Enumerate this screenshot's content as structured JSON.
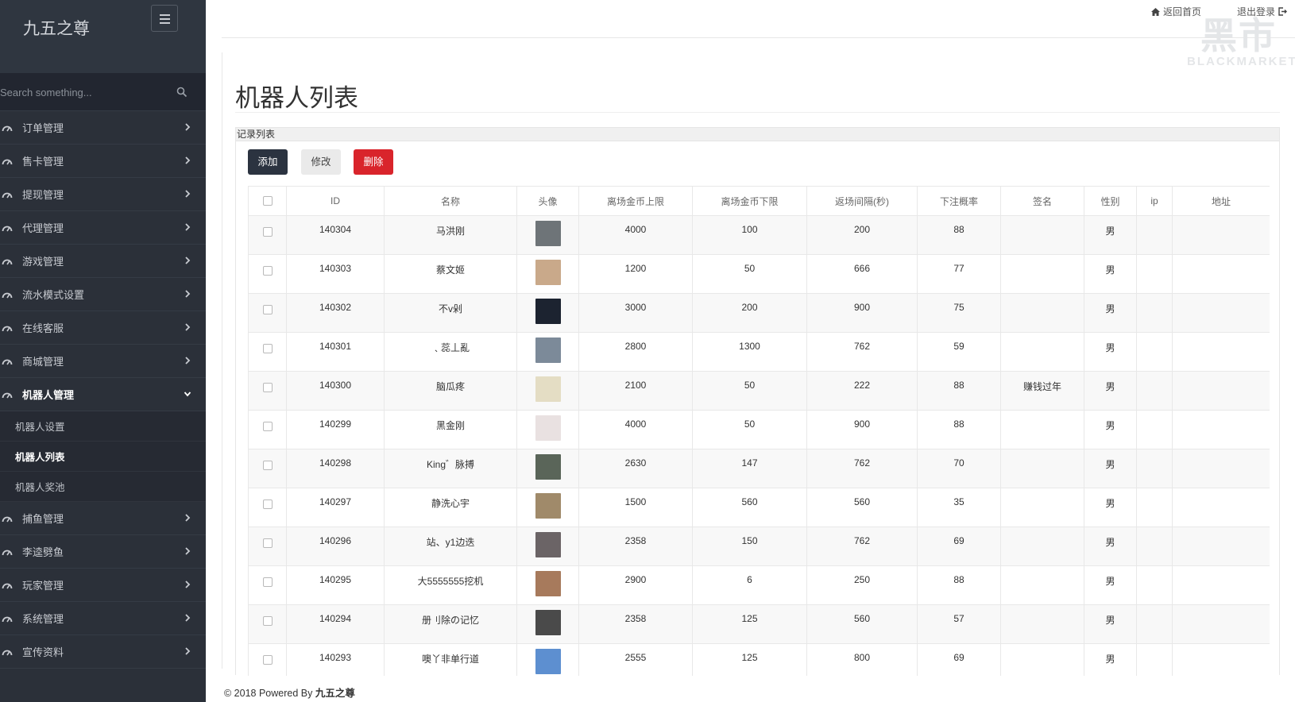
{
  "brand": {
    "title": "九五之尊"
  },
  "search": {
    "placeholder": "Search something..."
  },
  "menu": [
    {
      "label": "订单管理"
    },
    {
      "label": "售卡管理"
    },
    {
      "label": "提现管理"
    },
    {
      "label": "代理管理"
    },
    {
      "label": "游戏管理"
    },
    {
      "label": "流水模式设置"
    },
    {
      "label": "在线客服"
    },
    {
      "label": "商城管理"
    },
    {
      "label": "机器人管理"
    },
    {
      "label": "捕鱼管理"
    },
    {
      "label": "李逵劈鱼"
    },
    {
      "label": "玩家管理"
    },
    {
      "label": "系统管理"
    },
    {
      "label": "宣传资料"
    }
  ],
  "submenu": [
    {
      "label": "机器人设置"
    },
    {
      "label": "机器人列表"
    },
    {
      "label": "机器人奖池"
    }
  ],
  "topbar": {
    "home": "返回首页",
    "logout": "退出登录"
  },
  "watermark": {
    "big": "黑市",
    "small": "BLACKMARKET"
  },
  "page": {
    "title": "机器人列表",
    "panel_title": "记录列表"
  },
  "actions": {
    "add": "添加",
    "edit": "修改",
    "delete": "删除"
  },
  "table": {
    "headers": [
      "ID",
      "名称",
      "头像",
      "离场金币上限",
      "离场金币下限",
      "返场间隔(秒)",
      "下注概率",
      "签名",
      "性别",
      "ip",
      "地址"
    ],
    "rows": [
      {
        "id": "140304",
        "name": "马洪刚",
        "max": "4000",
        "min": "100",
        "interval": "200",
        "prob": "88",
        "sign": "",
        "gender": "男",
        "ip": "",
        "addr": "",
        "avatar_color": "#6e7478"
      },
      {
        "id": "140303",
        "name": "蔡文姬",
        "max": "1200",
        "min": "50",
        "interval": "666",
        "prob": "77",
        "sign": "",
        "gender": "男",
        "ip": "",
        "addr": "",
        "avatar_color": "#c9a98a"
      },
      {
        "id": "140302",
        "name": "不v剁",
        "max": "3000",
        "min": "200",
        "interval": "900",
        "prob": "75",
        "sign": "",
        "gender": "男",
        "ip": "",
        "addr": "",
        "avatar_color": "#1c2330"
      },
      {
        "id": "140301",
        "name": "﹑蕊丄亂",
        "max": "2800",
        "min": "1300",
        "interval": "762",
        "prob": "59",
        "sign": "",
        "gender": "男",
        "ip": "",
        "addr": "",
        "avatar_color": "#7c8a99"
      },
      {
        "id": "140300",
        "name": "脑瓜疼",
        "max": "2100",
        "min": "50",
        "interval": "222",
        "prob": "88",
        "sign": "赚钱过年",
        "gender": "男",
        "ip": "",
        "addr": "",
        "avatar_color": "#e4ddc4"
      },
      {
        "id": "140299",
        "name": "黑金刚",
        "max": "4000",
        "min": "50",
        "interval": "900",
        "prob": "88",
        "sign": "",
        "gender": "男",
        "ip": "",
        "addr": "",
        "avatar_color": "#e9e1e1"
      },
      {
        "id": "140298",
        "name": "King゛脉搏",
        "max": "2630",
        "min": "147",
        "interval": "762",
        "prob": "70",
        "sign": "",
        "gender": "男",
        "ip": "",
        "addr": "",
        "avatar_color": "#5a6559"
      },
      {
        "id": "140297",
        "name": "静洗心宇",
        "max": "1500",
        "min": "560",
        "interval": "560",
        "prob": "35",
        "sign": "",
        "gender": "男",
        "ip": "",
        "addr": "",
        "avatar_color": "#a08a6a"
      },
      {
        "id": "140296",
        "name": "站、y1边迭",
        "max": "2358",
        "min": "150",
        "interval": "762",
        "prob": "69",
        "sign": "",
        "gender": "男",
        "ip": "",
        "addr": "",
        "avatar_color": "#6b6466"
      },
      {
        "id": "140295",
        "name": "大5555555挖机",
        "max": "2900",
        "min": "6",
        "interval": "250",
        "prob": "88",
        "sign": "",
        "gender": "男",
        "ip": "",
        "addr": "",
        "avatar_color": "#a77a5c"
      },
      {
        "id": "140294",
        "name": "册刂除の记忆",
        "max": "2358",
        "min": "125",
        "interval": "560",
        "prob": "57",
        "sign": "",
        "gender": "男",
        "ip": "",
        "addr": "",
        "avatar_color": "#4a4a4a"
      },
      {
        "id": "140293",
        "name": "噢丫非单行道",
        "max": "2555",
        "min": "125",
        "interval": "800",
        "prob": "69",
        "sign": "",
        "gender": "男",
        "ip": "",
        "addr": "",
        "avatar_color": "#5d8fd0"
      }
    ]
  },
  "footer": {
    "prefix": "© 2018 Powered By ",
    "brand": "九五之尊"
  },
  "colors": {
    "sidebar": "#2b3039",
    "primary_btn": "#2b3340",
    "danger_btn": "#d9242b"
  }
}
